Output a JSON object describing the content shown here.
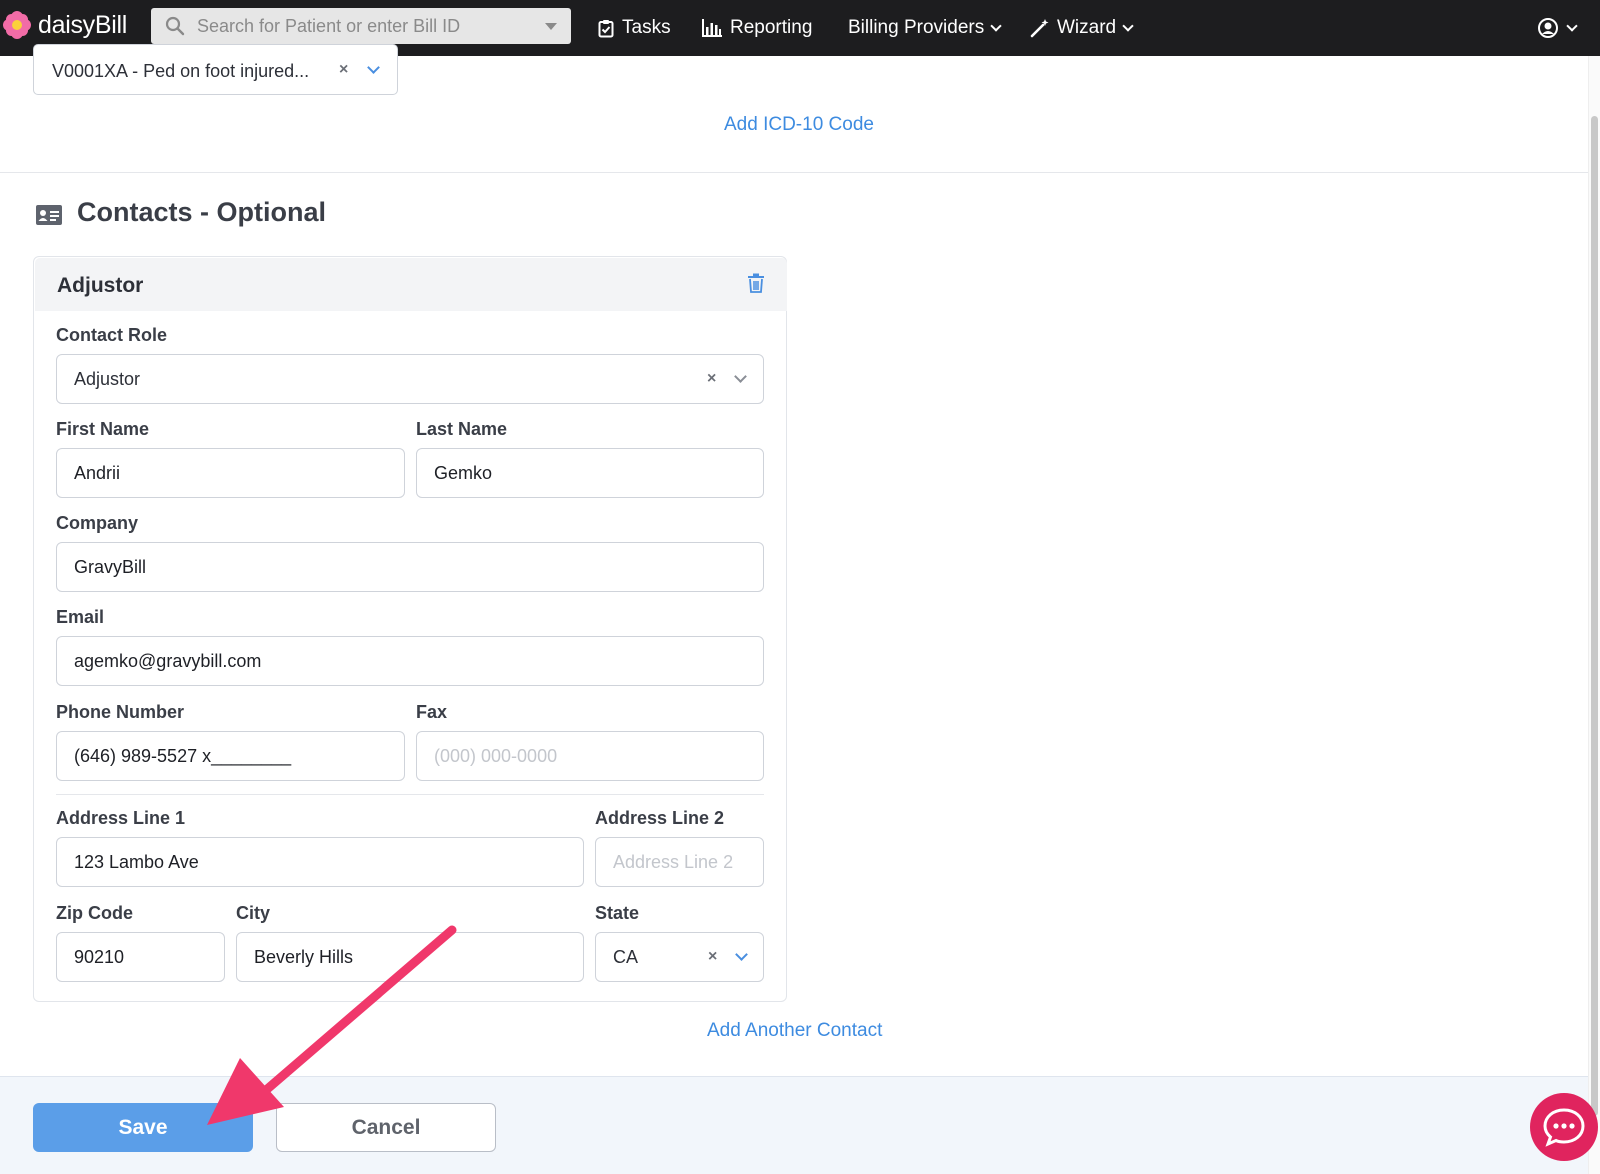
{
  "nav": {
    "logo_text": "daisyBill",
    "search_placeholder": "Search for Patient or enter Bill ID",
    "items": [
      {
        "label": "Tasks",
        "icon": "clipboard-check-icon"
      },
      {
        "label": "Reporting",
        "icon": "bar-chart-icon"
      },
      {
        "label": "Billing Providers",
        "icon": "chevron-down-icon"
      },
      {
        "label": "Wizard",
        "icon": "magic-wand-icon"
      }
    ],
    "user_icon": "user-circle-icon"
  },
  "diagnosis": {
    "selected_code": "V0001XA - Ped on foot injured...",
    "add_link": "Add ICD-10 Code"
  },
  "contacts": {
    "section_title": "Contacts - Optional",
    "section_icon": "contact-card-icon",
    "card_title": "Adjustor",
    "labels": {
      "contact_role": "Contact Role",
      "first_name": "First Name",
      "last_name": "Last Name",
      "company": "Company",
      "email": "Email",
      "phone": "Phone Number",
      "fax": "Fax",
      "address1": "Address Line 1",
      "address2": "Address Line 2",
      "zip": "Zip Code",
      "city": "City",
      "state": "State"
    },
    "values": {
      "contact_role": "Adjustor",
      "first_name": "Andrii",
      "last_name": "Gemko",
      "company": "GravyBill",
      "email": "agemko@gravybill.com",
      "phone": "(646) 989-5527 x________",
      "fax": "",
      "address1": "123 Lambo Ave",
      "address2": "",
      "zip": "90210",
      "city": "Beverly Hills",
      "state": "CA"
    },
    "placeholders": {
      "fax": "(000) 000-0000",
      "address2": "Address Line 2"
    },
    "add_link": "Add Another Contact"
  },
  "footer": {
    "save_label": "Save",
    "cancel_label": "Cancel"
  },
  "colors": {
    "nav_bg": "#1d1d1f",
    "link": "#3d8be0",
    "save_button": "#5b9ee8",
    "annotation_arrow": "#f0386b",
    "chat_button": "#e0245e"
  }
}
